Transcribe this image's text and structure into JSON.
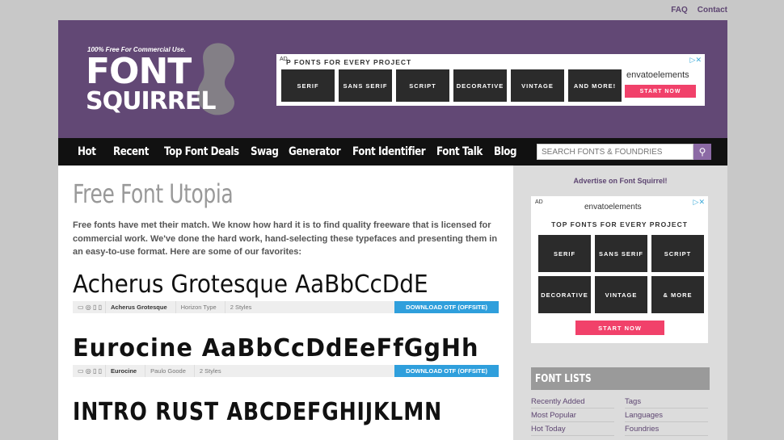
{
  "toplinks": {
    "faq": "FAQ",
    "contact": "Contact"
  },
  "logo": {
    "tagline": "100% Free For Commercial Use.",
    "word1": "FONT",
    "word2": "SQUIRREL"
  },
  "header_ad": {
    "ad_label": "AD",
    "title": "P FONTS FOR EVERY PROJECT",
    "tiles": [
      "SERIF",
      "SANS SERIF",
      "SCRIPT",
      "DECORATIVE",
      "VINTAGE",
      "AND MORE!"
    ],
    "brand": "envatoelements",
    "cta": "START NOW",
    "close": "▷✕"
  },
  "nav": {
    "items": [
      "Hot",
      "Recent",
      "Top Font Deals",
      "Swag",
      "Generator",
      "Font Identifier",
      "Font Talk",
      "Blog"
    ],
    "search_placeholder": "SEARCH FONTS & FOUNDRIES"
  },
  "main": {
    "title": "Free Font Utopia",
    "intro": "Free fonts have met their match. We know how hard it is to find quality freeware that is licensed for commercial work. We've done the hard work, hand-selecting these typefaces and presenting them in an easy-to-use format. Here are some of our favorites:",
    "fonts": [
      {
        "sample": "Acherus Grotesque AaBbCcDdE",
        "name": "Acherus Grotesque",
        "foundry": "Horizon Type",
        "styles": "2 Styles",
        "download": "DOWNLOAD OTF (OFFSITE)"
      },
      {
        "sample": "Eurocine AaBbCcDdEeFfGgHh",
        "name": "Eurocine",
        "foundry": "Paulo Goode",
        "styles": "2 Styles",
        "download": "DOWNLOAD OTF (OFFSITE)"
      },
      {
        "sample": "INTRO RUST ABCDEFGHIJKLMN"
      }
    ]
  },
  "sidebar": {
    "advertise": "Advertise on Font Squirrel!",
    "ad": {
      "ad_label": "AD",
      "brand": "envatoelements",
      "title": "TOP FONTS FOR EVERY PROJECT",
      "tiles": [
        "SERIF",
        "SANS SERIF",
        "SCRIPT",
        "DECORATIVE",
        "VINTAGE",
        "& MORE"
      ],
      "cta": "START NOW",
      "close": "▷✕"
    },
    "font_lists_title": "FONT LISTS",
    "links": [
      "Recently Added",
      "Tags",
      "Most Popular",
      "Languages",
      "Hot Today",
      "Foundries"
    ]
  }
}
